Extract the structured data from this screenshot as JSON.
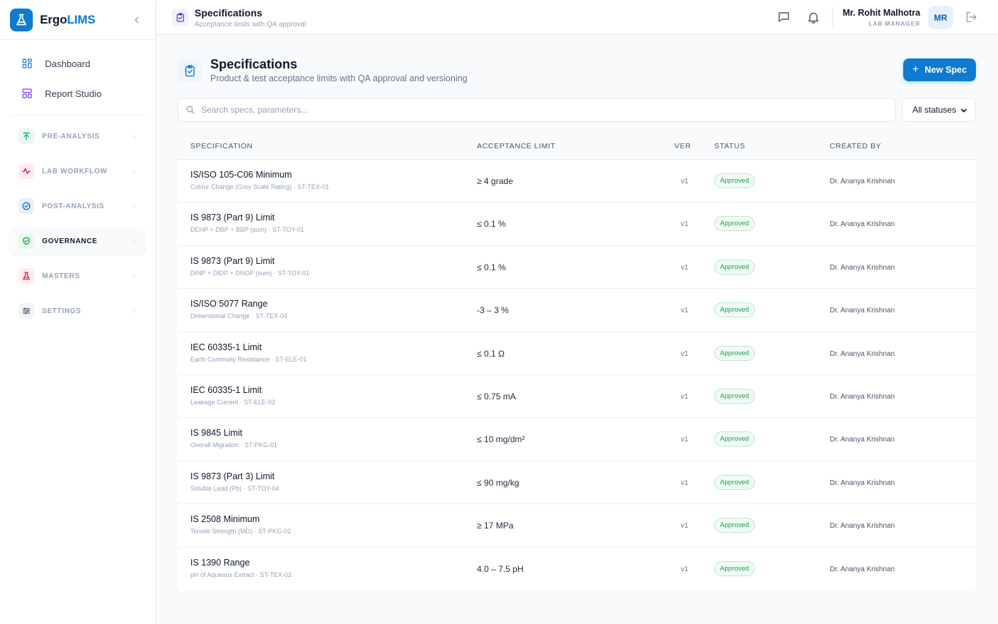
{
  "app": {
    "brand_prefix": "Ergo",
    "brand_suffix": "LIMS"
  },
  "sidebar": {
    "links": [
      {
        "label": "Dashboard",
        "icon": "grid-icon"
      },
      {
        "label": "Report Studio",
        "icon": "layout-icon"
      }
    ],
    "groups": [
      {
        "label": "PRE-ANALYSIS",
        "icon": "upload-arrow-icon",
        "color": "#10b981",
        "bg": "#e9f8f1"
      },
      {
        "label": "LAB WORKFLOW",
        "icon": "activity-icon",
        "color": "#e11d48",
        "bg": "#fdecef"
      },
      {
        "label": "POST-ANALYSIS",
        "icon": "check-circle-icon",
        "color": "#0c7bd1",
        "bg": "#e8f1fb"
      },
      {
        "label": "GOVERNANCE",
        "icon": "shield-check-icon",
        "color": "#16a34a",
        "bg": "#e9f8ee",
        "active": true
      },
      {
        "label": "MASTERS",
        "icon": "flask-icon",
        "color": "#e11d48",
        "bg": "#fdecef"
      },
      {
        "label": "SETTINGS",
        "icon": "sliders-icon",
        "color": "#475569",
        "bg": "#f1f5f9"
      }
    ]
  },
  "topbar": {
    "title": "Specifications",
    "subtitle": "Acceptance limits with QA approval",
    "user_name": "Mr. Rohit Malhotra",
    "user_role": "LAB MANAGER",
    "avatar_initials": "MR"
  },
  "page": {
    "title": "Specifications",
    "subtitle": "Product & test acceptance limits with QA approval and versioning",
    "new_button": "New Spec"
  },
  "filters": {
    "search_placeholder": "Search specs, parameters...",
    "status_selected": "All statuses"
  },
  "table": {
    "columns": [
      "SPECIFICATION",
      "ACCEPTANCE LIMIT",
      "VER",
      "STATUS",
      "CREATED BY"
    ],
    "rows": [
      {
        "name": "IS/ISO 105-C06 Minimum",
        "meta": "Colour Change (Grey Scale Rating) · ST-TEX-01",
        "limit": "≥ 4 grade",
        "ver": "v1",
        "status": "Approved",
        "created_by": "Dr. Ananya Krishnan"
      },
      {
        "name": "IS 9873 (Part 9) Limit",
        "meta": "DEHP + DBP + BBP (sum) · ST-TOY-01",
        "limit": "≤ 0.1 %",
        "ver": "v1",
        "status": "Approved",
        "created_by": "Dr. Ananya Krishnan"
      },
      {
        "name": "IS 9873 (Part 9) Limit",
        "meta": "DINP + DIDP + DNOP (sum) · ST-TOY-01",
        "limit": "≤ 0.1 %",
        "ver": "v1",
        "status": "Approved",
        "created_by": "Dr. Ananya Krishnan"
      },
      {
        "name": "IS/ISO 5077 Range",
        "meta": "Dimensional Change · ST-TEX-04",
        "limit": "-3 – 3 %",
        "ver": "v1",
        "status": "Approved",
        "created_by": "Dr. Ananya Krishnan"
      },
      {
        "name": "IEC 60335-1 Limit",
        "meta": "Earth Continuity Resistance · ST-ELE-01",
        "limit": "≤ 0.1 Ω",
        "ver": "v1",
        "status": "Approved",
        "created_by": "Dr. Ananya Krishnan"
      },
      {
        "name": "IEC 60335-1 Limit",
        "meta": "Leakage Current · ST-ELE-02",
        "limit": "≤ 0.75 mA",
        "ver": "v1",
        "status": "Approved",
        "created_by": "Dr. Ananya Krishnan"
      },
      {
        "name": "IS 9845 Limit",
        "meta": "Overall Migration · ST-PKG-01",
        "limit": "≤ 10 mg/dm²",
        "ver": "v1",
        "status": "Approved",
        "created_by": "Dr. Ananya Krishnan"
      },
      {
        "name": "IS 9873 (Part 3) Limit",
        "meta": "Soluble Lead (Pb) · ST-TOY-04",
        "limit": "≤ 90 mg/kg",
        "ver": "v1",
        "status": "Approved",
        "created_by": "Dr. Ananya Krishnan"
      },
      {
        "name": "IS 2508 Minimum",
        "meta": "Tensile Strength (MD) · ST-PKG-02",
        "limit": "≥ 17 MPa",
        "ver": "v1",
        "status": "Approved",
        "created_by": "Dr. Ananya Krishnan"
      },
      {
        "name": "IS 1390 Range",
        "meta": "pH of Aqueous Extract · ST-TEX-02",
        "limit": "4.0 – 7.5 pH",
        "ver": "v1",
        "status": "Approved",
        "created_by": "Dr. Ananya Krishnan"
      }
    ]
  },
  "colors": {
    "accent": "#0c7bd1",
    "status_approved": "#16a34a"
  }
}
